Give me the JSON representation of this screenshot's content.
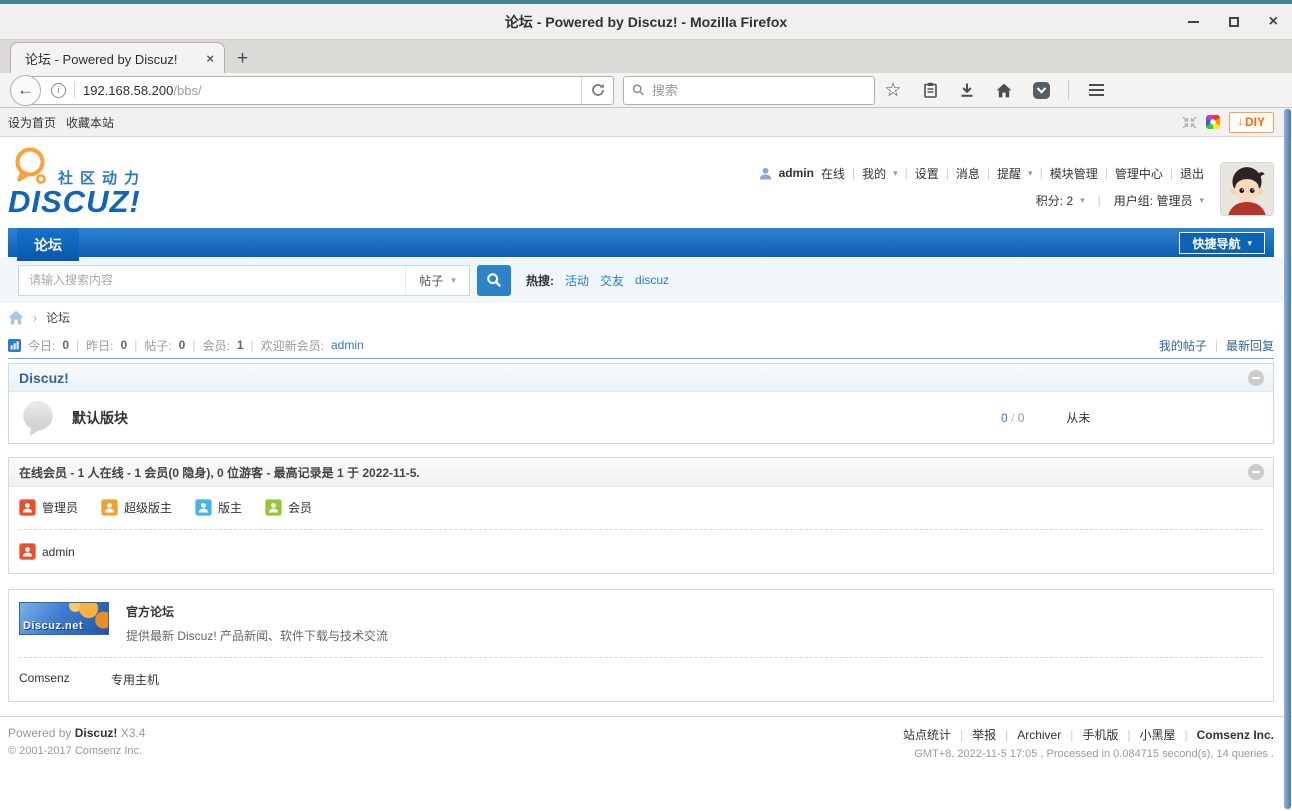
{
  "browser": {
    "window_title": "论坛  -  Powered by Discuz! - Mozilla Firefox",
    "tab_title": "论坛 - Powered by Discuz!",
    "url_host": "192.168.58.200",
    "url_path": "/bbs/",
    "search_placeholder": "搜索"
  },
  "page": {
    "topbar": {
      "set_home": "设为首页",
      "bookmark": "收藏本站",
      "diy": "DIY"
    },
    "header": {
      "tagline": "社区动力",
      "logo_text": "DISCUZ!",
      "username": "admin",
      "online_label": "在线",
      "menu_mine": "我的",
      "menu_settings": "设置",
      "menu_messages": "消息",
      "menu_alerts": "提醒",
      "menu_modules": "模块管理",
      "menu_admin": "管理中心",
      "menu_logout": "退出",
      "credits": "积分: 2",
      "usergroup": "用户组: 管理员"
    },
    "nav": {
      "forum_tab": "论坛",
      "quick_nav": "快捷导航"
    },
    "searchbar": {
      "placeholder": "请输入搜索内容",
      "scope": "帖子",
      "hot_label": "热搜:",
      "hot_1": "活动",
      "hot_2": "交友",
      "hot_3": "discuz"
    },
    "breadcrumb": {
      "current": "论坛"
    },
    "statsbar": {
      "items": [
        {
          "label": "今日:",
          "value": "0"
        },
        {
          "label": "昨日:",
          "value": "0"
        },
        {
          "label": "帖子:",
          "value": "0"
        },
        {
          "label": "会员:",
          "value": "1"
        }
      ],
      "welcome_label": "欢迎新会员:",
      "welcome_user": "admin",
      "my_posts": "我的帖子",
      "latest_reply": "最新回复"
    },
    "category": {
      "title": "Discuz!",
      "forum_name": "默认版块",
      "topics": "0",
      "posts": "0",
      "last_post": "从未"
    },
    "online": {
      "title": "在线会员 - 1 人在线 - 1 会员(0 隐身), 0 位游客 - 最高记录是 1 于 2022-11-5.",
      "legend": [
        {
          "label": "管理员",
          "color": "#e8502d"
        },
        {
          "label": "超级版主",
          "color": "#f0a12f"
        },
        {
          "label": "版主",
          "color": "#49b3e3"
        },
        {
          "label": "会员",
          "color": "#96c637"
        }
      ],
      "member": {
        "name": "admin",
        "color": "#e8502d"
      }
    },
    "promo": {
      "banner_text": "Discuz.net",
      "title": "官方论坛",
      "desc": "提供最新 Discuz! 产品新闻、软件下载与技术交流",
      "partner": "Comsenz",
      "partner_item": "专用主机"
    },
    "footer": {
      "powered_prefix": "Powered by",
      "brand": "Discuz!",
      "version": "X3.4",
      "copyright": "© 2001-2017 Comsenz Inc.",
      "link_stats": "站点统计",
      "link_report": "举报",
      "link_archiver": "Archiver",
      "link_mobile": "手机版",
      "link_darkroom": "小黑屋",
      "company": "Comsenz Inc.",
      "meta": "GMT+8, 2022-11-5 17:05 , Processed in 0.084715 second(s), 14 queries ."
    },
    "colors": {
      "accent_blue": "#2b7acd",
      "link_blue": "#336699",
      "diy_orange": "#ff6600"
    }
  }
}
